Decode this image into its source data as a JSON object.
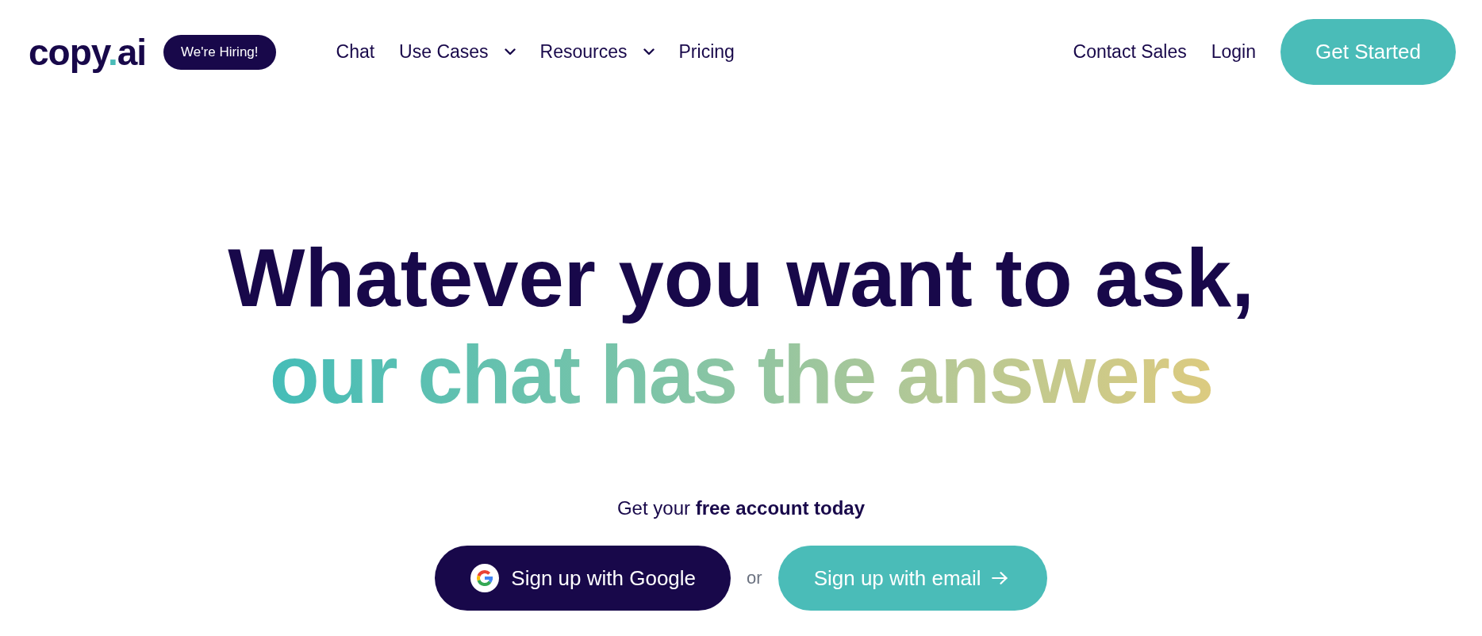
{
  "header": {
    "logo": {
      "parts": [
        {
          "text": "copy",
          "accent": false
        },
        {
          "text": ".",
          "accent": true
        },
        {
          "text": "ai",
          "accent": false
        }
      ]
    },
    "badge": "We're Hiring!",
    "nav": [
      {
        "label": "Chat",
        "dropdown": false
      },
      {
        "label": "Use Cases",
        "dropdown": true
      },
      {
        "label": "Resources",
        "dropdown": true
      },
      {
        "label": "Pricing",
        "dropdown": false
      }
    ],
    "links": [
      "Contact Sales",
      "Login"
    ],
    "cta": "Get Started"
  },
  "hero": {
    "heading": [
      {
        "text": "Whatever you want to ask,",
        "kind": "plain"
      },
      {
        "text": "our chat has the answers",
        "kind": "gradient"
      }
    ],
    "subtitle": "Get your **free account today**",
    "signup_buttons": [
      {
        "label": "Sign up with Google",
        "kind": "google"
      },
      {
        "label": "Sign up with email",
        "kind": "email"
      }
    ],
    "separator": "or"
  }
}
